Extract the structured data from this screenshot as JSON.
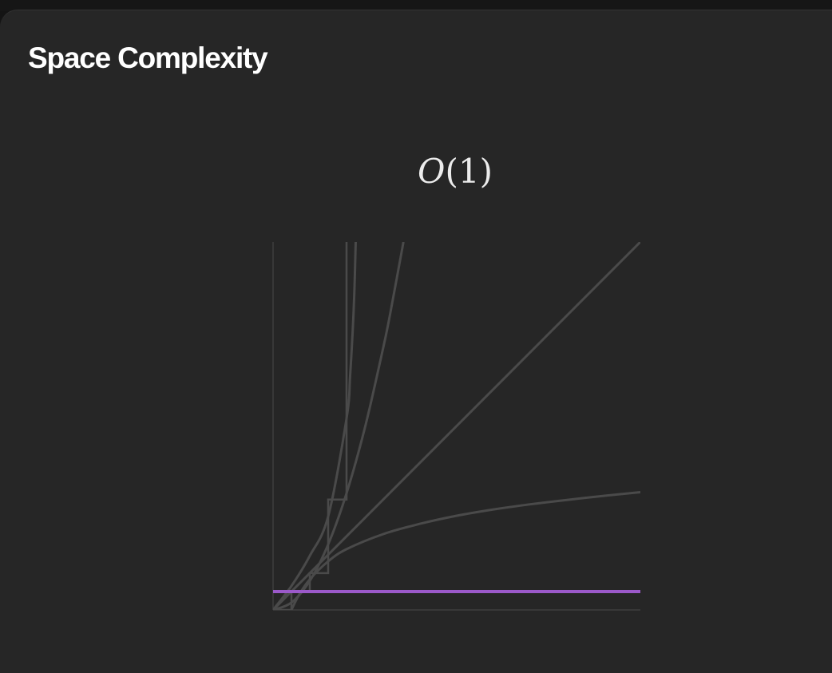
{
  "card": {
    "title": "Space Complexity"
  },
  "complexity": {
    "symbol": "O",
    "argument": "(1)"
  },
  "colors": {
    "background": "#262626",
    "highlight": "#9b59c9",
    "curve": "#4a4a4a",
    "axis": "#3f3f3f"
  },
  "chart_data": {
    "type": "line",
    "title": "",
    "xlabel": "",
    "ylabel": "",
    "xlim": [
      0,
      10
    ],
    "ylim": [
      0,
      10
    ],
    "grid": false,
    "highlighted": "constant",
    "series": [
      {
        "id": "constant",
        "highlight": true,
        "x": [
          0,
          10
        ],
        "y": [
          0.5,
          0.5
        ]
      },
      {
        "id": "logarithmic",
        "highlight": false,
        "x": [
          0.5,
          0.7,
          1,
          1.5,
          2,
          3,
          4,
          5,
          6,
          7,
          8,
          9,
          10
        ],
        "y": [
          0,
          0.4,
          0.83,
          1.32,
          1.65,
          2.06,
          2.34,
          2.56,
          2.73,
          2.87,
          2.99,
          3.1,
          3.2
        ]
      },
      {
        "id": "linear",
        "highlight": false,
        "x": [
          0,
          10
        ],
        "y": [
          0,
          10
        ]
      },
      {
        "id": "quadratic",
        "highlight": false,
        "x": [
          0,
          0.5,
          1,
          1.5,
          2,
          2.5,
          3,
          3.2,
          3.55
        ],
        "y": [
          0,
          0.2,
          0.79,
          1.78,
          3.17,
          4.95,
          7.13,
          8.11,
          10
        ]
      },
      {
        "id": "exponential",
        "highlight": false,
        "x": [
          0,
          0.5,
          1,
          1.5,
          2,
          2.1,
          2.2,
          2.25
        ],
        "y": [
          0,
          0.65,
          1.47,
          2.54,
          5.2,
          6.4,
          8.3,
          10
        ]
      },
      {
        "id": "factorial",
        "highlight": false,
        "step": true,
        "x": [
          0,
          0.5,
          1,
          1.5,
          2,
          2.02
        ],
        "y": [
          0,
          0.5,
          1,
          3,
          10,
          10
        ]
      }
    ]
  }
}
